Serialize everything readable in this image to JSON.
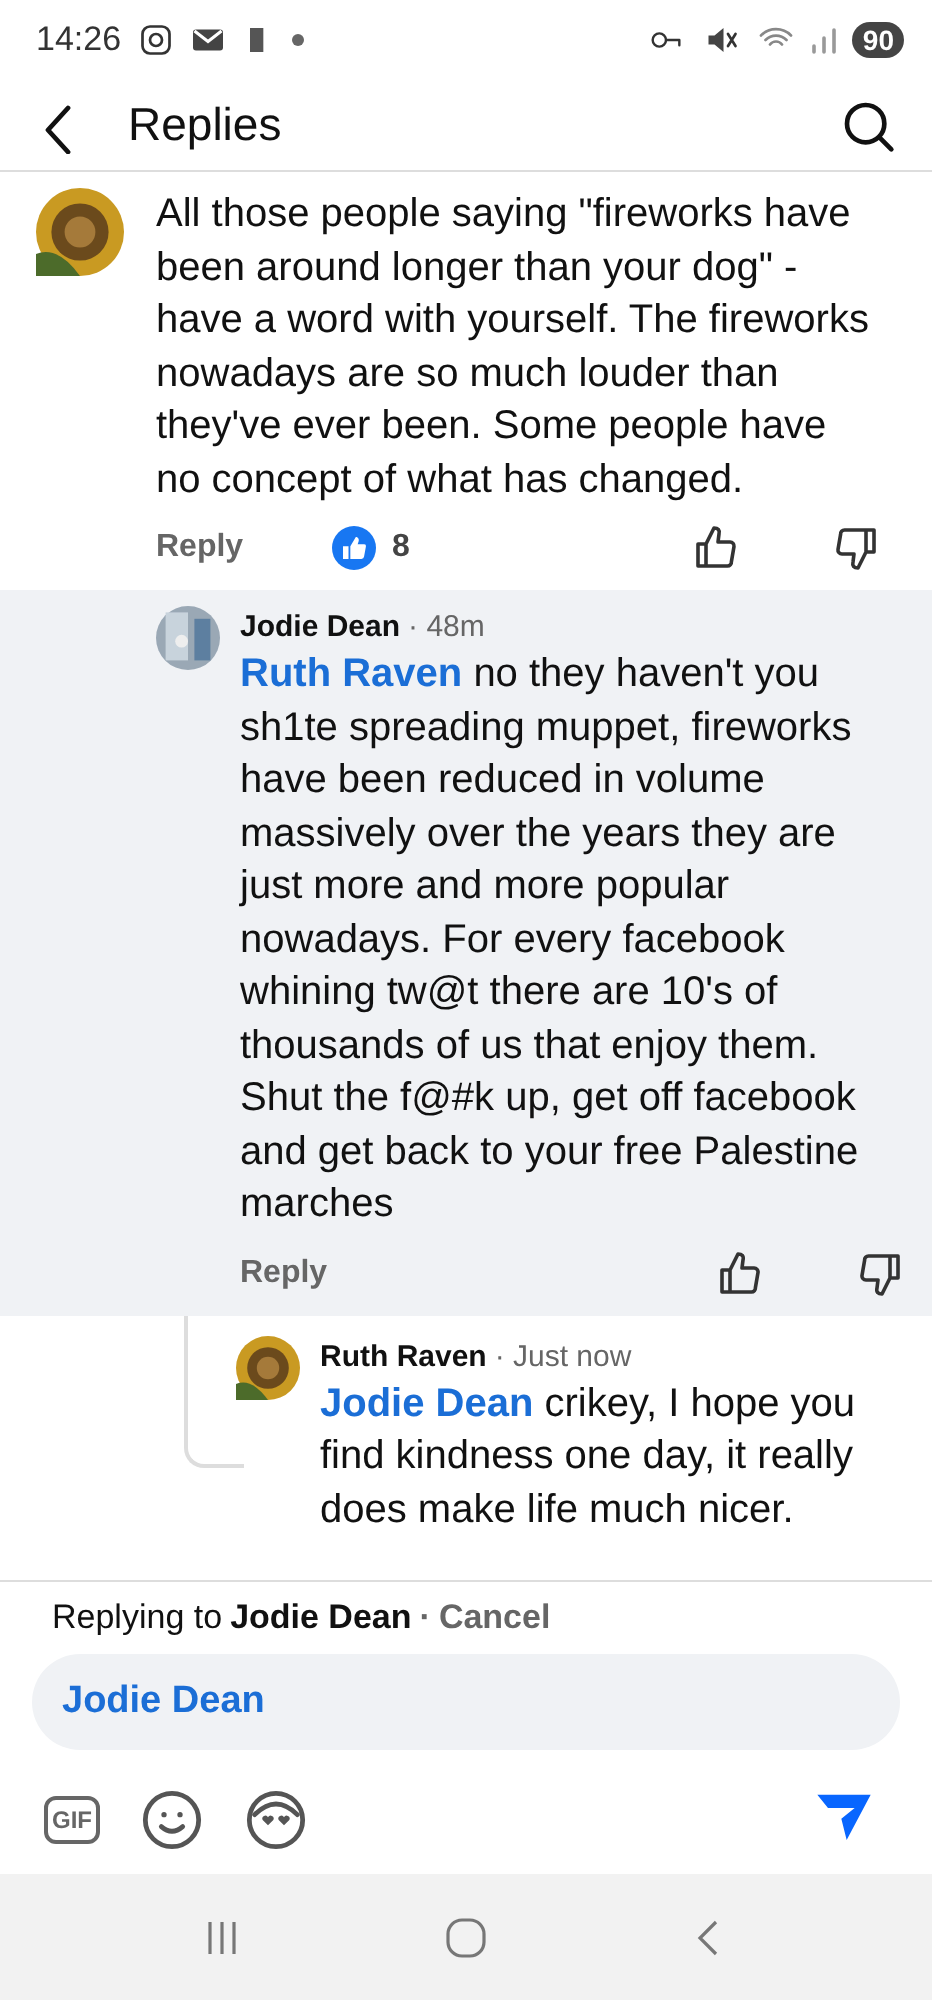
{
  "status_bar": {
    "time": "14:26",
    "battery": "90"
  },
  "header": {
    "title": "Replies"
  },
  "comments": [
    {
      "text": "All those people saying \"fireworks have been around longer than your dog\" - have a word with yourself. The fireworks nowadays are so much louder than they've ever been. Some people have no concept of what has changed.",
      "reply_label": "Reply",
      "reactions": "8",
      "highlighted": false,
      "children": [
        {
          "author": "Jodie Dean",
          "time": "· 48m",
          "mention": "Ruth Raven",
          "text": "no they haven't you sh1te spreading muppet, fireworks have been reduced in volume massively over the years they are just more and more popular nowadays. For every facebook whining tw@t there are 10's of thousands of us that enjoy them. Shut the f@#k up, get off facebook and get back to your free Palestine marches",
          "reply_label": "Reply",
          "highlighted": true,
          "children": [
            {
              "author": "Ruth Raven",
              "time": "· Just now",
              "mention": "Jodie Dean",
              "text": "crikey, I hope you find kindness one day, it really does make life much nicer.",
              "highlighted": false
            }
          ]
        }
      ]
    }
  ],
  "composer": {
    "replying_prefix": "Replying to",
    "replying_to": "Jodie Dean",
    "separator": "·",
    "cancel": "Cancel",
    "value": "Jodie Dean",
    "gif_label": "GIF"
  }
}
